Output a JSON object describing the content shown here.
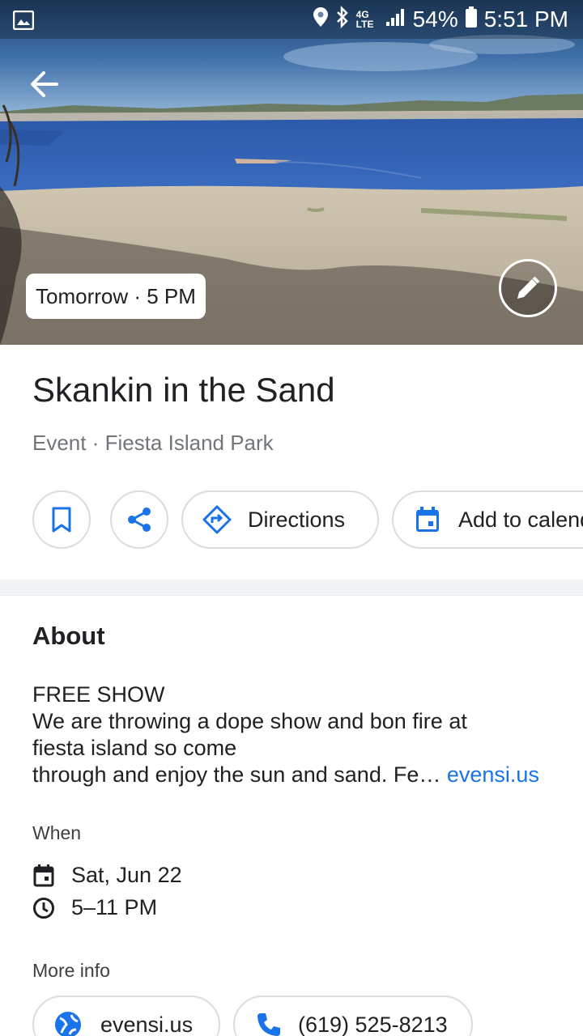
{
  "status_bar": {
    "battery": "54%",
    "time": "5:51 PM",
    "network": "4G LTE"
  },
  "hero": {
    "time_chip": "Tomorrow · 5 PM"
  },
  "event": {
    "title": "Skankin in the Sand",
    "subtitle": "Event · Fiesta Island Park"
  },
  "actions": {
    "directions_label": "Directions",
    "add_calendar_label": "Add to calendar"
  },
  "about": {
    "heading": "About",
    "line1": "FREE SHOW",
    "line2": "We are throwing a dope show and bon fire at",
    "line3": "fiesta island so come",
    "line4": "through and enjoy the sun and sand. Fe…",
    "link": "evensi.us"
  },
  "when": {
    "heading": "When",
    "date": "Sat, Jun 22",
    "time": "5–11 PM"
  },
  "more_info": {
    "heading": "More info",
    "website": "evensi.us",
    "phone": "(619) 525-8213"
  },
  "icons": [
    "image-icon",
    "location-icon",
    "bluetooth-icon",
    "signal-icon",
    "battery-icon",
    "back-arrow-icon",
    "pencil-icon",
    "bookmark-icon",
    "share-icon",
    "directions-icon",
    "calendar-icon",
    "clock-icon",
    "globe-icon",
    "phone-icon"
  ],
  "colors": {
    "accent": "#1a73e8",
    "text_primary": "#202124",
    "text_secondary": "#70757a",
    "chip_border": "#dadce0"
  }
}
